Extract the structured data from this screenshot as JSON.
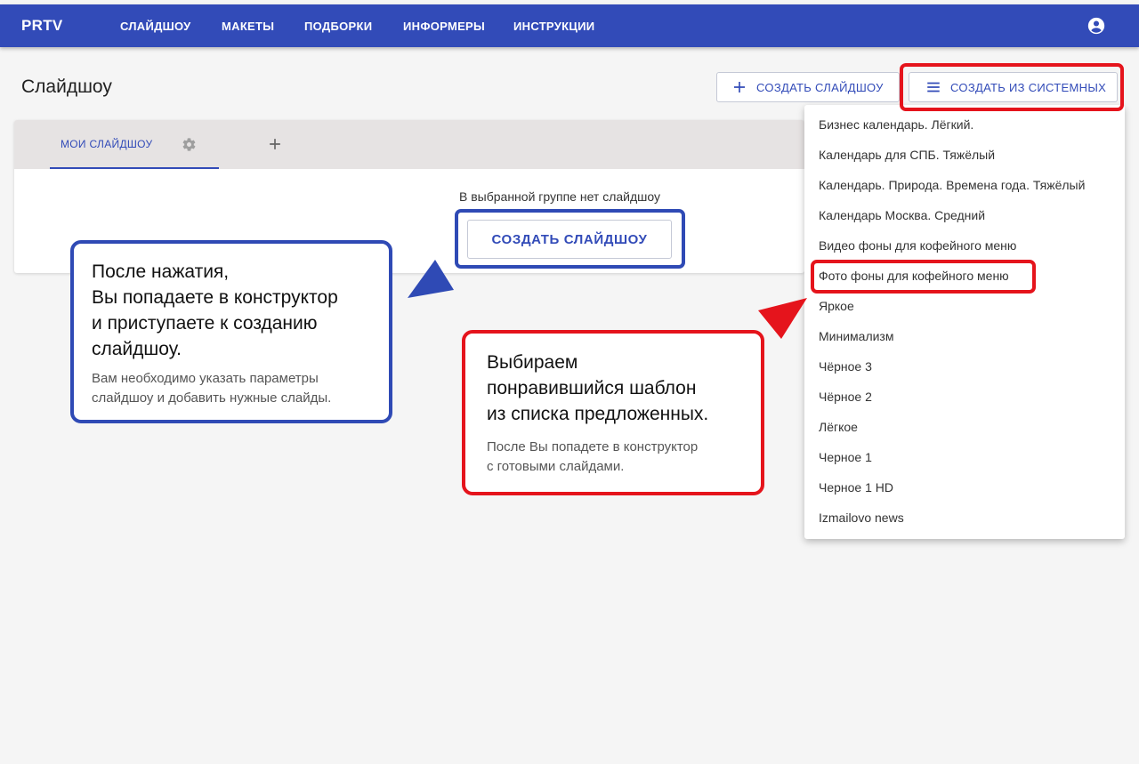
{
  "topbar": {
    "brand": "PRTV",
    "nav": [
      "СЛАЙДШОУ",
      "МАКЕТЫ",
      "ПОДБОРКИ",
      "ИНФОРМЕРЫ",
      "ИНСТРУКЦИИ"
    ],
    "account_icon": "account-circle-icon"
  },
  "page": {
    "title": "Слайдшоу",
    "create_button": "СОЗДАТЬ СЛАЙДШОУ",
    "create_from_system_button": "СОЗДАТЬ ИЗ СИСТЕМНЫХ"
  },
  "tabs": {
    "active_label": "МОИ СЛАЙДШОУ",
    "settings_icon": "gear-icon",
    "add_icon": "plus-icon"
  },
  "empty_state": {
    "message": "В выбранной группе нет слайдшоу",
    "button": "СОЗДАТЬ СЛАЙДШОУ"
  },
  "dropdown": {
    "items": [
      "Бизнес календарь. Лёгкий.",
      "Календарь для СПБ. Тяжёлый",
      "Календарь. Природа. Времена года. Тяжёлый",
      "Календарь Москва. Средний",
      "Видео фоны для кофейного меню",
      "Фото фоны для кофейного меню",
      "Яркое",
      "Минимализм",
      "Чёрное 3",
      "Чёрное 2",
      "Лёгкое",
      "Черное 1",
      "Черное 1 HD",
      "Izmailovo news"
    ]
  },
  "annotations": {
    "blue": {
      "lines": [
        "После нажатия,",
        "Вы попадаете в конструктор",
        "и приступаете к созданию",
        "слайдшоу."
      ],
      "sub_lines": [
        "Вам необходимо указать параметры",
        "слайдшоу и добавить нужные слайды."
      ]
    },
    "red": {
      "lines": [
        "Выбираем",
        "понравившийся шаблон",
        "из списка предложенных."
      ],
      "sub_lines": [
        "После Вы попадете в конструктор",
        "с готовыми слайдами."
      ]
    }
  },
  "colors": {
    "primary": "#324bb8",
    "highlight_red": "#e5141c",
    "highlight_blue": "#2f4ab5"
  }
}
